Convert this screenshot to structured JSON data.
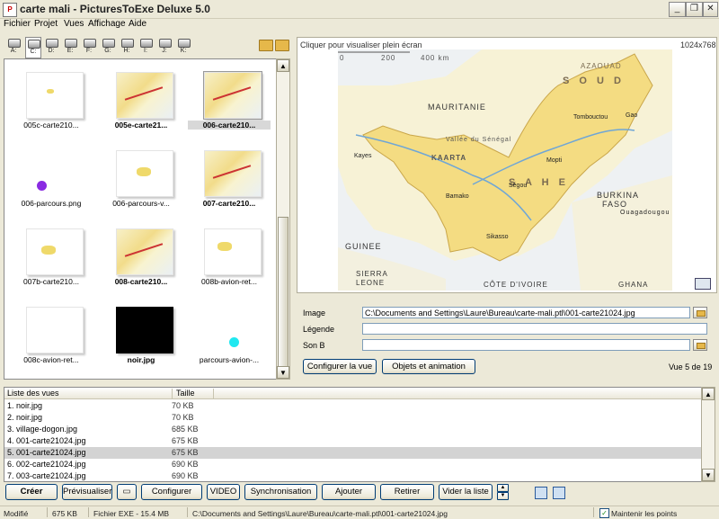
{
  "window": {
    "title": "carte mali - PicturesToExe Deluxe 5.0",
    "icon": "app-icon",
    "controls": [
      "minimize",
      "maximize",
      "close"
    ]
  },
  "menu": [
    "Fichier",
    "Projet",
    "Vues",
    "Affichage",
    "Aide"
  ],
  "drives": [
    "A:",
    "C:",
    "D:",
    "E:",
    "F:",
    "G:",
    "H:",
    "I:",
    "J:",
    "K:"
  ],
  "thumbnails": [
    {
      "label": "005c-carte210...",
      "kind": "blob",
      "selected": false,
      "bold": false
    },
    {
      "label": "005e-carte21...",
      "kind": "map",
      "selected": false,
      "bold": true
    },
    {
      "label": "006-carte210...",
      "kind": "map",
      "selected": true,
      "bold": true
    },
    {
      "label": "006-parcours.png",
      "kind": "purple-dot",
      "selected": false,
      "bold": false
    },
    {
      "label": "006-parcours-v...",
      "kind": "blob",
      "selected": false,
      "bold": false
    },
    {
      "label": "007-carte210...",
      "kind": "map",
      "selected": false,
      "bold": true
    },
    {
      "label": "007b-carte210...",
      "kind": "blob",
      "selected": false,
      "bold": false
    },
    {
      "label": "008-carte210...",
      "kind": "map",
      "selected": false,
      "bold": true
    },
    {
      "label": "008b-avion-ret...",
      "kind": "blob",
      "selected": false,
      "bold": false
    },
    {
      "label": "008c-avion-ret...",
      "kind": "blank",
      "selected": false,
      "bold": false
    },
    {
      "label": "noir.jpg",
      "kind": "black",
      "selected": false,
      "bold": true
    },
    {
      "label": "parcours-avion-...",
      "kind": "cyan-dot",
      "selected": false,
      "bold": false
    }
  ],
  "preview": {
    "hint": "Cliquer pour visualiser plein écran",
    "resolution": "1024x768",
    "map_labels": {
      "countries": [
        "MAURITANIE",
        "S O U D",
        "S A H E",
        "BURKINA",
        "FASO",
        "GUINEE",
        "SIERRA",
        "LEONE",
        "CÔTE D'IVOIRE",
        "GHANA"
      ],
      "cities": [
        "Bamako",
        "Ouagadougou",
        "Kayes",
        "Sikasso",
        "Ségou",
        "Mopti",
        "Gao",
        "Tombouctou"
      ],
      "regions": [
        "KAARTA",
        "Vallée du Sénégal",
        "AZAOUAD"
      ],
      "scale": [
        "0",
        "200",
        "400 km"
      ]
    }
  },
  "fields": {
    "image_label": "Image",
    "image_value": "C:\\Documents and Settings\\Laure\\Bureau\\carte-mali.ptl\\001-carte21024.jpg",
    "legende_label": "Légende",
    "legende_value": "",
    "son_label": "Son B",
    "son_value": ""
  },
  "buttons_mid": {
    "configure_view": "Configurer la vue",
    "objects_animation": "Objets et animation"
  },
  "slide_count": "Vue 5 de 19",
  "list": {
    "headers": [
      "Liste des vues",
      "Taille"
    ],
    "rows": [
      {
        "name": "1. noir.jpg",
        "size": "70 KB",
        "selected": false
      },
      {
        "name": "2. noir.jpg",
        "size": "70 KB",
        "selected": false
      },
      {
        "name": "3. village-dogon.jpg",
        "size": "685 KB",
        "selected": false
      },
      {
        "name": "4. 001-carte21024.jpg",
        "size": "675 KB",
        "selected": false
      },
      {
        "name": "5. 001-carte21024.jpg",
        "size": "675 KB",
        "selected": true
      },
      {
        "name": "6. 002-carte21024.jpg",
        "size": "690 KB",
        "selected": false
      },
      {
        "name": "7. 003-carte21024.jpg",
        "size": "690 KB",
        "selected": false
      }
    ]
  },
  "bottom_buttons": {
    "create": "Créer",
    "preview": "Prévisualiser",
    "configure": "Configurer",
    "video": "VIDEO",
    "sync": "Synchronisation",
    "add": "Ajouter",
    "remove": "Retirer",
    "clear": "Vider la liste"
  },
  "status": {
    "state": "Modifié",
    "size": "675 KB",
    "exe": "Fichier EXE - 15.4 MB",
    "path": "C:\\Documents and Settings\\Laure\\Bureau\\carte-mali.ptl\\001-carte21024.jpg",
    "keep_points": "Maintenir les points",
    "keep_points_checked": true
  }
}
